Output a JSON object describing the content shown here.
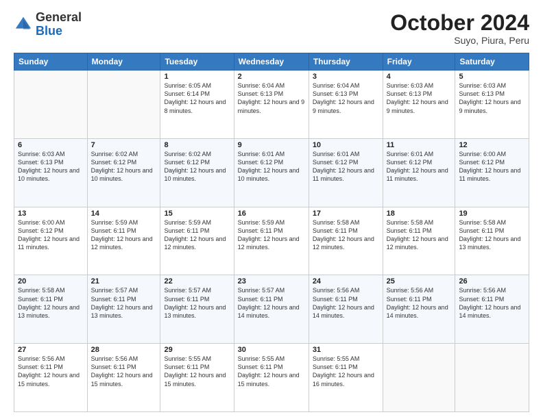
{
  "header": {
    "logo_general": "General",
    "logo_blue": "Blue",
    "month": "October 2024",
    "location": "Suyo, Piura, Peru"
  },
  "weekdays": [
    "Sunday",
    "Monday",
    "Tuesday",
    "Wednesday",
    "Thursday",
    "Friday",
    "Saturday"
  ],
  "weeks": [
    [
      {
        "day": "",
        "info": ""
      },
      {
        "day": "",
        "info": ""
      },
      {
        "day": "1",
        "info": "Sunrise: 6:05 AM\nSunset: 6:14 PM\nDaylight: 12 hours and 8 minutes."
      },
      {
        "day": "2",
        "info": "Sunrise: 6:04 AM\nSunset: 6:13 PM\nDaylight: 12 hours and 9 minutes."
      },
      {
        "day": "3",
        "info": "Sunrise: 6:04 AM\nSunset: 6:13 PM\nDaylight: 12 hours and 9 minutes."
      },
      {
        "day": "4",
        "info": "Sunrise: 6:03 AM\nSunset: 6:13 PM\nDaylight: 12 hours and 9 minutes."
      },
      {
        "day": "5",
        "info": "Sunrise: 6:03 AM\nSunset: 6:13 PM\nDaylight: 12 hours and 9 minutes."
      }
    ],
    [
      {
        "day": "6",
        "info": "Sunrise: 6:03 AM\nSunset: 6:13 PM\nDaylight: 12 hours and 10 minutes."
      },
      {
        "day": "7",
        "info": "Sunrise: 6:02 AM\nSunset: 6:12 PM\nDaylight: 12 hours and 10 minutes."
      },
      {
        "day": "8",
        "info": "Sunrise: 6:02 AM\nSunset: 6:12 PM\nDaylight: 12 hours and 10 minutes."
      },
      {
        "day": "9",
        "info": "Sunrise: 6:01 AM\nSunset: 6:12 PM\nDaylight: 12 hours and 10 minutes."
      },
      {
        "day": "10",
        "info": "Sunrise: 6:01 AM\nSunset: 6:12 PM\nDaylight: 12 hours and 11 minutes."
      },
      {
        "day": "11",
        "info": "Sunrise: 6:01 AM\nSunset: 6:12 PM\nDaylight: 12 hours and 11 minutes."
      },
      {
        "day": "12",
        "info": "Sunrise: 6:00 AM\nSunset: 6:12 PM\nDaylight: 12 hours and 11 minutes."
      }
    ],
    [
      {
        "day": "13",
        "info": "Sunrise: 6:00 AM\nSunset: 6:12 PM\nDaylight: 12 hours and 11 minutes."
      },
      {
        "day": "14",
        "info": "Sunrise: 5:59 AM\nSunset: 6:11 PM\nDaylight: 12 hours and 12 minutes."
      },
      {
        "day": "15",
        "info": "Sunrise: 5:59 AM\nSunset: 6:11 PM\nDaylight: 12 hours and 12 minutes."
      },
      {
        "day": "16",
        "info": "Sunrise: 5:59 AM\nSunset: 6:11 PM\nDaylight: 12 hours and 12 minutes."
      },
      {
        "day": "17",
        "info": "Sunrise: 5:58 AM\nSunset: 6:11 PM\nDaylight: 12 hours and 12 minutes."
      },
      {
        "day": "18",
        "info": "Sunrise: 5:58 AM\nSunset: 6:11 PM\nDaylight: 12 hours and 12 minutes."
      },
      {
        "day": "19",
        "info": "Sunrise: 5:58 AM\nSunset: 6:11 PM\nDaylight: 12 hours and 13 minutes."
      }
    ],
    [
      {
        "day": "20",
        "info": "Sunrise: 5:58 AM\nSunset: 6:11 PM\nDaylight: 12 hours and 13 minutes."
      },
      {
        "day": "21",
        "info": "Sunrise: 5:57 AM\nSunset: 6:11 PM\nDaylight: 12 hours and 13 minutes."
      },
      {
        "day": "22",
        "info": "Sunrise: 5:57 AM\nSunset: 6:11 PM\nDaylight: 12 hours and 13 minutes."
      },
      {
        "day": "23",
        "info": "Sunrise: 5:57 AM\nSunset: 6:11 PM\nDaylight: 12 hours and 14 minutes."
      },
      {
        "day": "24",
        "info": "Sunrise: 5:56 AM\nSunset: 6:11 PM\nDaylight: 12 hours and 14 minutes."
      },
      {
        "day": "25",
        "info": "Sunrise: 5:56 AM\nSunset: 6:11 PM\nDaylight: 12 hours and 14 minutes."
      },
      {
        "day": "26",
        "info": "Sunrise: 5:56 AM\nSunset: 6:11 PM\nDaylight: 12 hours and 14 minutes."
      }
    ],
    [
      {
        "day": "27",
        "info": "Sunrise: 5:56 AM\nSunset: 6:11 PM\nDaylight: 12 hours and 15 minutes."
      },
      {
        "day": "28",
        "info": "Sunrise: 5:56 AM\nSunset: 6:11 PM\nDaylight: 12 hours and 15 minutes."
      },
      {
        "day": "29",
        "info": "Sunrise: 5:55 AM\nSunset: 6:11 PM\nDaylight: 12 hours and 15 minutes."
      },
      {
        "day": "30",
        "info": "Sunrise: 5:55 AM\nSunset: 6:11 PM\nDaylight: 12 hours and 15 minutes."
      },
      {
        "day": "31",
        "info": "Sunrise: 5:55 AM\nSunset: 6:11 PM\nDaylight: 12 hours and 16 minutes."
      },
      {
        "day": "",
        "info": ""
      },
      {
        "day": "",
        "info": ""
      }
    ]
  ]
}
